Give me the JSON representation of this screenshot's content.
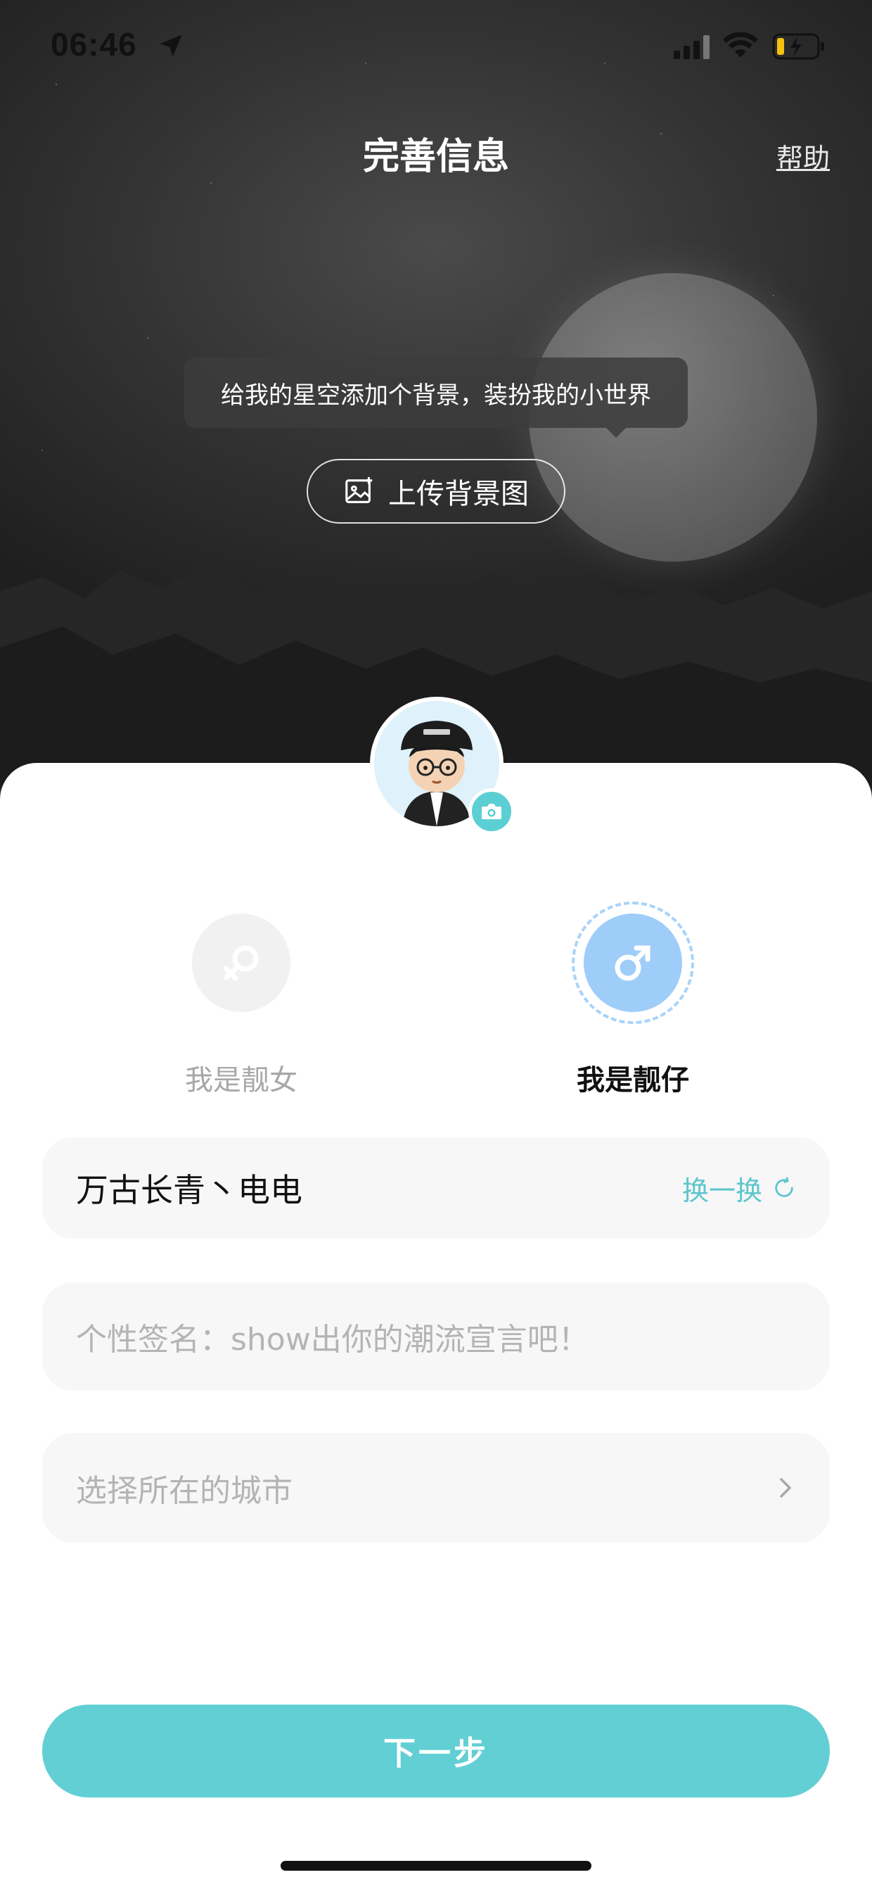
{
  "status_bar": {
    "time": "06:46"
  },
  "header": {
    "title": "完善信息",
    "help": "帮助"
  },
  "hero": {
    "tooltip": "给我的星空添加个背景，装扮我的小世界",
    "upload_label": "上传背景图"
  },
  "gender": {
    "female_label": "我是靓女",
    "male_label": "我是靓仔",
    "selected": "male"
  },
  "form": {
    "nickname_value": "万古长青丶电电",
    "refresh_label": "换一换",
    "signature_placeholder": "个性签名：show出你的潮流宣言吧！",
    "city_placeholder": "选择所在的城市"
  },
  "next_button": "下一步",
  "colors": {
    "accent": "#62cfd4",
    "male": "#9fcdfa",
    "field_bg": "#f7f7f7"
  }
}
